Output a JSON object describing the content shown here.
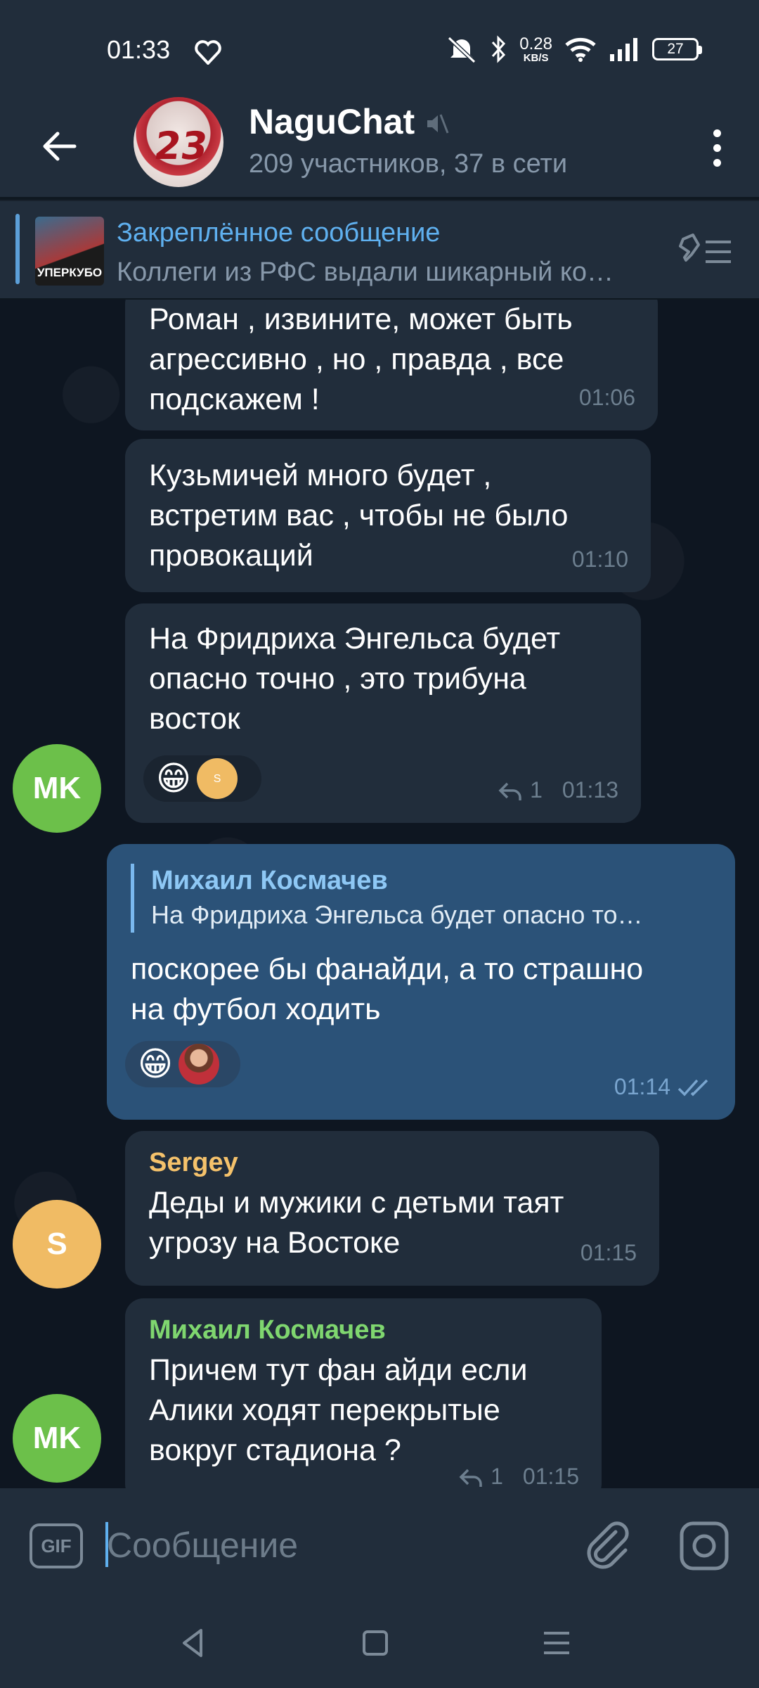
{
  "status_bar": {
    "time": "01:33",
    "net_speed_value": "0.28",
    "net_speed_unit": "KB/S",
    "battery": "27"
  },
  "header": {
    "title": "NaguChat",
    "subtitle": "209 участников, 37 в сети",
    "avatar_text": "23"
  },
  "pinned": {
    "title": "Закреплённое сообщение",
    "text": "Коллеги из РФС выдали шикарный ко…",
    "thumb_text": "УПЕРКУБО"
  },
  "messages": [
    {
      "text_lines": [
        "Роман , извините, может быть",
        "агрессивно , но , правда , все",
        "подскажем !"
      ],
      "time": "01:06"
    },
    {
      "text_lines": [
        "Кузьмичей много будет ,",
        "встретим вас , чтобы не было",
        "провокаций"
      ],
      "time": "01:10"
    },
    {
      "text_lines": [
        "На Фридриха Энгельса будет",
        "опасно точно , это трибуна",
        "восток"
      ],
      "time": "01:13",
      "reply_count": "1",
      "reaction_avatar_letter": "S",
      "author_avatar": "MK"
    },
    {
      "reply_name": "Михаил Космачев",
      "reply_text": "На Фридриха Энгельса будет опасно то…",
      "text_lines": [
        "поскорее бы фанайди, а то страшно",
        "на футбол ходить"
      ],
      "time": "01:14"
    },
    {
      "sender": "Sergey",
      "text_lines": [
        "Деды и мужики с детьми таят",
        "угрозу на Востоке"
      ],
      "time": "01:15",
      "author_avatar": "S"
    },
    {
      "sender": "Михаил Космачев",
      "text_lines": [
        "Причем тут фан айди если",
        "Алики ходят перекрытые",
        "вокруг стадиона ?"
      ],
      "time": "01:15",
      "reply_count": "1",
      "author_avatar": "MK"
    }
  ],
  "input": {
    "gif_label": "GIF",
    "placeholder": "Сообщение"
  },
  "colors": {
    "accent": "#5fb0ef",
    "incoming_bubble": "#212d3b",
    "outgoing_bubble": "#2b5278",
    "sender_sergey": "#f5c26b",
    "sender_mikhail": "#7fd66f",
    "avatar_mk": "#6cc04a",
    "avatar_s": "#f0bb64"
  },
  "icons": {
    "back": "arrow-left-icon",
    "mute": "muted-speaker-icon",
    "menu": "more-vertical-icon",
    "unpin": "pin-list-icon",
    "attach": "paperclip-icon",
    "camera": "camera-icon",
    "reply": "reply-arrow-icon",
    "read": "double-check-icon"
  }
}
